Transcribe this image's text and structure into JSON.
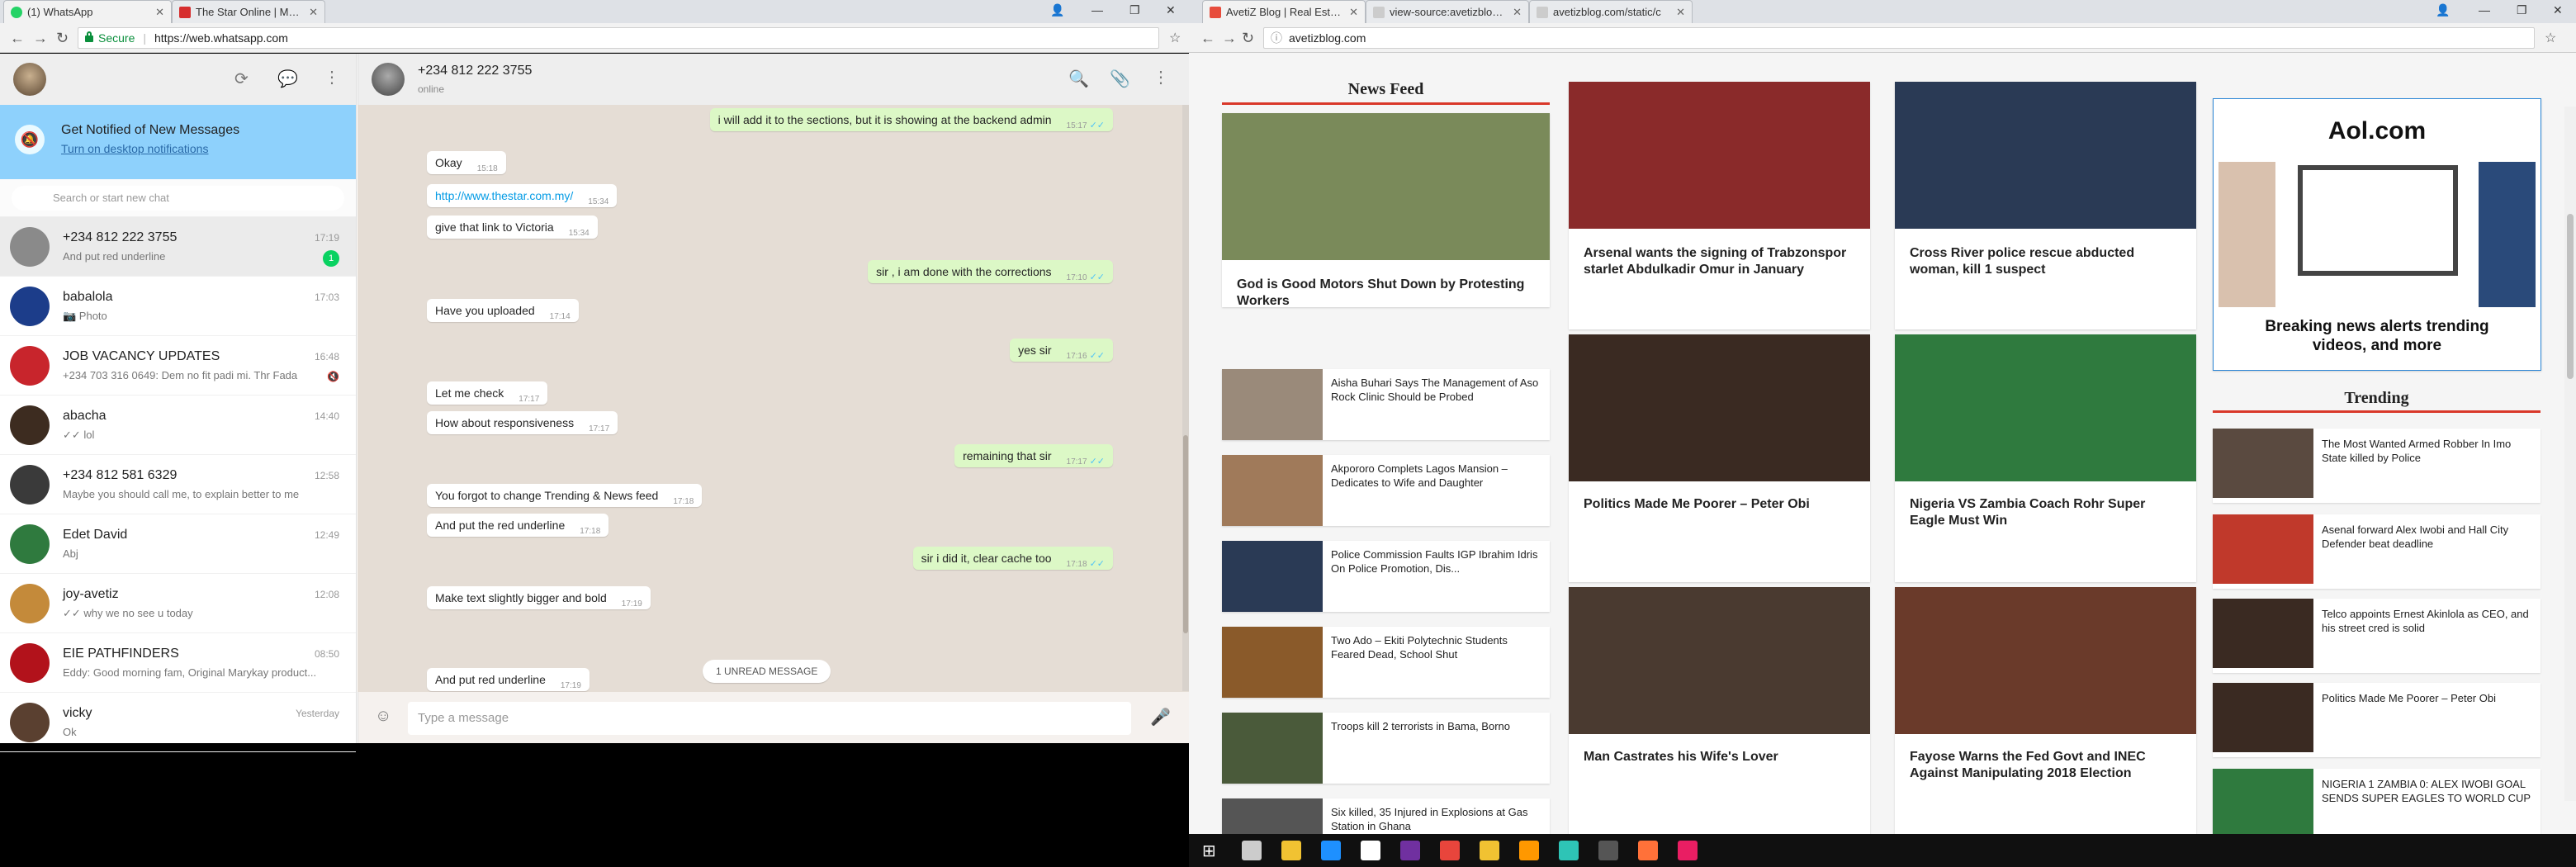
{
  "left_browser": {
    "tabs": [
      {
        "title": "(1) WhatsApp",
        "fav_color": "#25d366"
      },
      {
        "title": "The Star Online | Malaysi",
        "fav_color": "#d62e2e"
      }
    ],
    "secure_label": "Secure",
    "url": "https://web.whatsapp.com"
  },
  "whatsapp": {
    "notification": {
      "title": "Get Notified of New Messages",
      "link": "Turn on desktop notifications"
    },
    "search_placeholder": "Search or start new chat",
    "chats": [
      {
        "name": "+234 812 222 3755",
        "preview": "And put red underline",
        "time": "17:19",
        "badge": "1",
        "selected": true,
        "color": "#8a8a8a"
      },
      {
        "name": "babalola",
        "preview": "📷 Photo",
        "time": "17:03",
        "color": "#1c3d8a"
      },
      {
        "name": "JOB VACANCY UPDATES",
        "preview": "+234 703 316 0649: Dem no fit padi mi. Thr Fada",
        "time": "16:48",
        "muted": true,
        "color": "#c8252c"
      },
      {
        "name": "abacha",
        "preview": "✓✓ lol",
        "time": "14:40",
        "color": "#3d2c20"
      },
      {
        "name": "+234 812 581 6329",
        "preview": "Maybe you should call me, to explain better to me",
        "time": "12:58",
        "color": "#3a3a3a"
      },
      {
        "name": "Edet David",
        "preview": "Abj",
        "time": "12:49",
        "color": "#2f7a3e"
      },
      {
        "name": "joy-avetiz",
        "preview": "✓✓ why we no see u today",
        "time": "12:08",
        "color": "#c48a3a"
      },
      {
        "name": "EIE PATHFINDERS",
        "preview": "Eddy: Good morning fam, Original Marykay product...",
        "time": "08:50",
        "color": "#b2121b"
      },
      {
        "name": "vicky",
        "preview": "Ok",
        "time": "Yesterday",
        "color": "#5a4030"
      }
    ],
    "conversation": {
      "name": "+234 812 222 3755",
      "status": "online",
      "messages": [
        {
          "dir": "out",
          "text": "i will add it to the sections, but it is showing at the backend admin",
          "time": "15:17"
        },
        {
          "dir": "in",
          "text": "Okay",
          "time": "15:18"
        },
        {
          "dir": "in",
          "text": "http://www.thestar.com.my/",
          "time": "15:34",
          "link": true
        },
        {
          "dir": "in",
          "text": "give that link to Victoria",
          "time": "15:34"
        },
        {
          "dir": "out",
          "text": "sir , i am done with the corrections",
          "time": "17:10"
        },
        {
          "dir": "in",
          "text": "Have you uploaded",
          "time": "17:14"
        },
        {
          "dir": "out",
          "text": "yes sir",
          "time": "17:16"
        },
        {
          "dir": "in",
          "text": "Let me check",
          "time": "17:17"
        },
        {
          "dir": "in",
          "text": "How about responsiveness",
          "time": "17:17"
        },
        {
          "dir": "out",
          "text": "remaining that sir",
          "time": "17:17"
        },
        {
          "dir": "in",
          "text": "You forgot to change Trending & News feed",
          "time": "17:18"
        },
        {
          "dir": "in",
          "text": "And put the red underline",
          "time": "17:18"
        },
        {
          "dir": "out",
          "text": "sir i did it, clear cache too",
          "time": "17:18"
        },
        {
          "dir": "in",
          "text": "Make text slightly bigger and bold",
          "time": "17:19"
        },
        {
          "dir": "in",
          "text": "And put red underline",
          "time": "17:19"
        }
      ],
      "unread_label": "1 UNREAD MESSAGE",
      "compose_placeholder": "Type a message"
    }
  },
  "right_browser": {
    "tabs": [
      {
        "title": "AvetiZ Blog | Real Estate",
        "fav_color": "#e74c3c"
      },
      {
        "title": "view-source:avetizblog.co",
        "fav_color": "#888888"
      },
      {
        "title": "avetizblog.com/static/c",
        "fav_color": "#888888"
      }
    ],
    "url": "avetizblog.com"
  },
  "blog": {
    "news_feed_label": "News Feed",
    "trending_label": "Trending",
    "grid": [
      {
        "title": "God is Good Motors Shut Down by Protesting Workers",
        "img_color": "#7a8a5a"
      },
      {
        "title": "Arsenal wants the signing of Trabzonspor starlet Abdulkadir Omur in January",
        "img_color": "#8a2a2a"
      },
      {
        "title": "Cross River police rescue abducted woman, kill 1 suspect",
        "img_color": "#2a3a55"
      },
      {
        "title": "Politics Made Me Poorer – Peter Obi",
        "img_color": "#3a2a22"
      },
      {
        "title": "Nigeria VS Zambia Coach Rohr Super Eagle Must Win",
        "img_color": "#2f7a3e"
      },
      {
        "title": "Man Castrates his Wife's Lover",
        "img_color": "#4a3a30"
      },
      {
        "title": "Fayose Warns the Fed Govt and INEC Against Manipulating 2018 Election",
        "img_color": "#6a3a2a"
      }
    ],
    "feed_list": [
      {
        "title": "Aisha Buhari Says The Management of Aso Rock Clinic Should be Probed",
        "img_color": "#9a8a7a"
      },
      {
        "title": "Akpororo Complets Lagos Mansion – Dedicates to Wife and Daughter",
        "img_color": "#a07a5a"
      },
      {
        "title": "Police Commission Faults IGP Ibrahim Idris On Police Promotion, Dis...",
        "img_color": "#2a3a55"
      },
      {
        "title": "Two Ado – Ekiti Polytechnic Students Feared Dead, School Shut",
        "img_color": "#8a5a2a"
      },
      {
        "title": "Troops kill 2 terrorists in Bama, Borno",
        "img_color": "#4a5a3a"
      },
      {
        "title": "Six killed, 35 Injured in Explosions at Gas Station in Ghana",
        "img_color": "#555555"
      }
    ],
    "trending": [
      {
        "title": "The Most Wanted Armed Robber In Imo State killed by Police",
        "img_color": "#5a4a40"
      },
      {
        "title": "Asenal forward Alex Iwobi and Hall City Defender beat deadline",
        "img_color": "#c0392b"
      },
      {
        "title": "Telco appoints Ernest Akinlola as CEO, and his street cred is solid",
        "img_color": "#3a2a22"
      },
      {
        "title": "Politics Made Me Poorer – Peter Obi",
        "img_color": "#3a2a22"
      },
      {
        "title": "NIGERIA 1 ZAMBIA 0: ALEX IWOBI GOAL SENDS SUPER EAGLES TO WORLD CUP",
        "img_color": "#2f7a3e"
      }
    ],
    "ad": {
      "logo": "Aol.com",
      "text": "Breaking news alerts trending videos, and more"
    }
  },
  "taskbar": {
    "icons": [
      "windows-icon",
      "task-view-icon",
      "file-explorer-icon",
      "edge-icon",
      "store-icon",
      "onenote-icon",
      "chrome-icon",
      "folder-icon",
      "sublime-icon",
      "app-icon",
      "cmd-icon",
      "firefox-icon",
      "snipping-tool-icon"
    ]
  }
}
